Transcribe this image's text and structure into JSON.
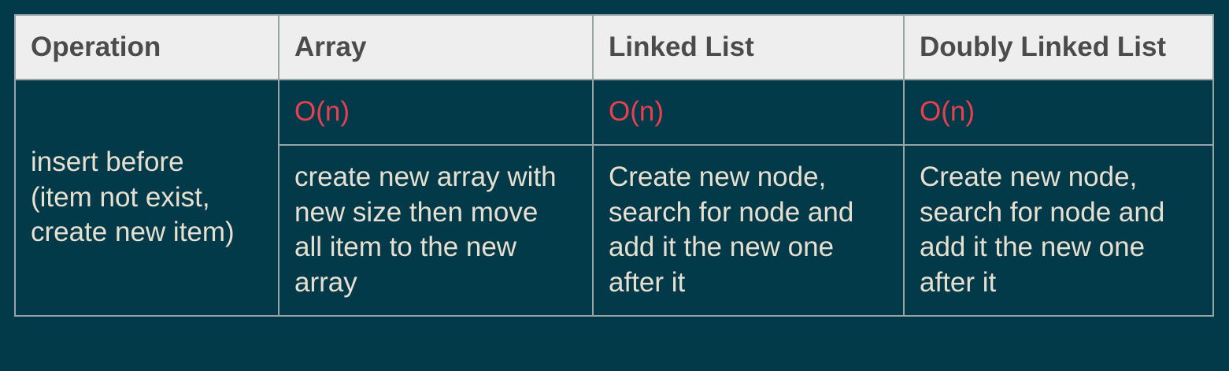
{
  "table": {
    "headers": [
      "Operation",
      "Array",
      "Linked List",
      "Doubly Linked List"
    ],
    "operation": "insert before (item not exist, create new item)",
    "operation_lines": [
      "insert before",
      "(item not exist,",
      "create new item)"
    ],
    "complexity": [
      "O(n)",
      "O(n)",
      "O(n)"
    ],
    "descriptions": [
      [
        "create new array with",
        "new size then move",
        "all item to the new",
        "array"
      ],
      [
        "Create new node,",
        "search for node and",
        "add it the new one",
        "after it"
      ],
      [
        "Create new node,",
        "search for node and",
        "add it the new one",
        "after it"
      ]
    ],
    "colors": {
      "background": "#033a4a",
      "header_background": "#eeeeee",
      "header_text": "#4b4b4b",
      "body_text": "#e7dfcf",
      "complexity_text": "#e8404f",
      "border": "#9aa3a6"
    }
  }
}
